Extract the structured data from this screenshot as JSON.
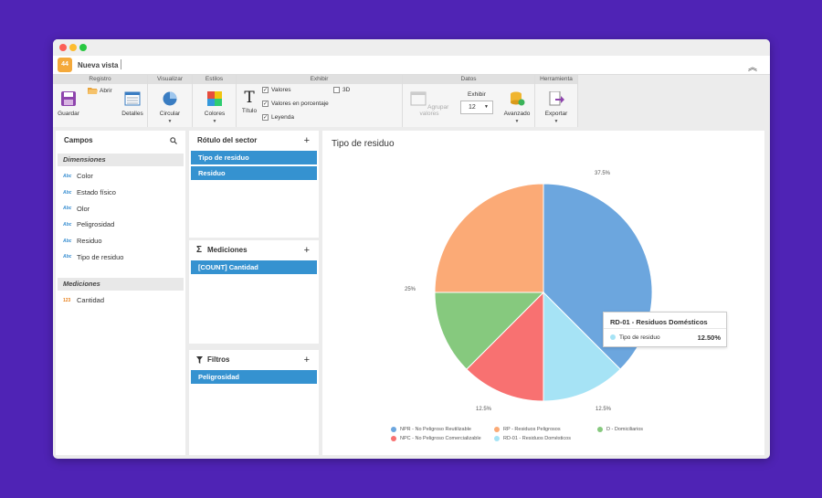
{
  "app": {
    "view_name": "Nueva vista",
    "logo_text": "44"
  },
  "ribbon": {
    "groups": [
      "Registro",
      "Visualizar",
      "Estilos",
      "Exhibir",
      "Datos",
      "Herramienta"
    ],
    "guardar": "Guardar",
    "abrir": "Abrir",
    "detalles": "Detalles",
    "circular": "Circular",
    "colores": "Colores",
    "titulo": "Título",
    "checks": {
      "valores": "Valores",
      "valores_porcentaje": "Valores en porcentaje",
      "leyenda": "Leyenda",
      "tres_d": "3D"
    },
    "agrupar": "Agrupar valores",
    "exhibir_label": "Exhibir",
    "exhibir_value": "12",
    "avanzado": "Avanzado",
    "exportar": "Exportar"
  },
  "campos": {
    "title": "Campos",
    "dimensiones_title": "Dimensiones",
    "dim_tag": "Abc",
    "dimensiones": [
      "Color",
      "Estado físico",
      "Olor",
      "Peligrosidad",
      "Residuo",
      "Tipo de residuo"
    ],
    "mediciones_title": "Mediciones",
    "med_tag": "123",
    "mediciones": [
      "Cantidad"
    ]
  },
  "rotulo": {
    "title": "Rótulo del sector",
    "chips": [
      "Tipo de residuo",
      "Residuo"
    ]
  },
  "mediciones_panel": {
    "title": "Mediciones",
    "chips": [
      "[COUNT] Cantidad"
    ]
  },
  "filtros": {
    "title": "Filtros",
    "chips": [
      "Peligrosidad"
    ]
  },
  "tooltip": {
    "title": "RD-01 - Residuos Domésticos",
    "name": "Tipo de residuo",
    "value": "12.50%"
  },
  "chart_data": {
    "type": "pie",
    "title": "Tipo de residuo",
    "slices": [
      {
        "label": "NPR - No Peligroso Reutilizable",
        "value": 37.5,
        "text": "37.5%",
        "color": "#6ca6de"
      },
      {
        "label": "RD-01 - Residuos Domésticos",
        "value": 12.5,
        "text": "",
        "color": "#a6e3f5"
      },
      {
        "label": "NPC - No Peligroso Comercializable",
        "value": 12.5,
        "text": "12.5%",
        "color": "#f87171"
      },
      {
        "label": "D - Domiciliarios",
        "value": 12.5,
        "text": "12.5%",
        "color": "#86c97e"
      },
      {
        "label": "RP - Residuos Peligrosos",
        "value": 25,
        "text": "25%",
        "color": "#fbaa76"
      }
    ],
    "legend": [
      {
        "label": "NPR - No Peligroso Reutilizable",
        "color": "#6ca6de"
      },
      {
        "label": "RP - Residuos Peligrosos",
        "color": "#fbaa76"
      },
      {
        "label": "D - Domiciliarios",
        "color": "#86c97e"
      },
      {
        "label": "NPC - No Peligroso Comercializable",
        "color": "#f87171"
      },
      {
        "label": "RD-01 - Residuos Domésticos",
        "color": "#a6e3f5"
      }
    ],
    "legend_placement": "bottom"
  }
}
